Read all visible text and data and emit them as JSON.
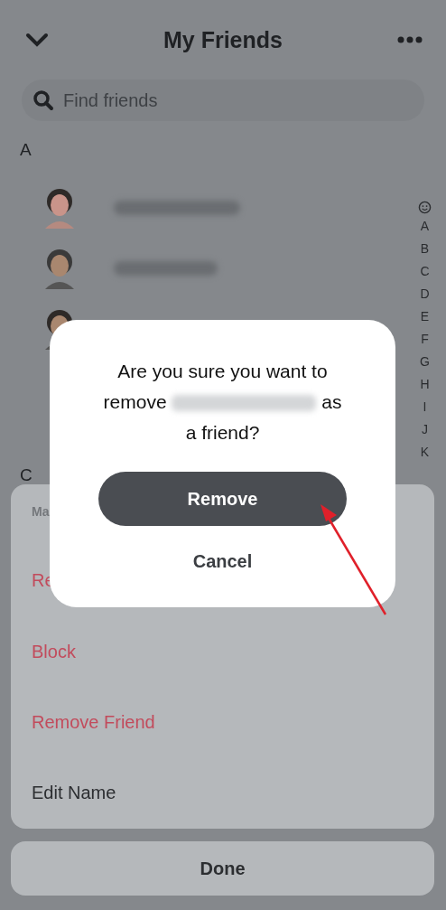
{
  "header": {
    "title": "My Friends"
  },
  "search": {
    "placeholder": "Find friends"
  },
  "sections": [
    {
      "letter": "A",
      "friends": [
        {
          "kind": "picture",
          "name_blurred": true
        },
        {
          "kind": "picture",
          "name_blurred": true
        },
        {
          "kind": "picture",
          "name_blurred": false
        }
      ]
    },
    {
      "letter": "C"
    }
  ],
  "index": [
    "A",
    "B",
    "C",
    "D",
    "E",
    "F",
    "G",
    "H",
    "I",
    "J",
    "K"
  ],
  "sheet": {
    "items": [
      {
        "kind": "header",
        "label": "Ma"
      },
      {
        "kind": "danger",
        "label": "Re"
      },
      {
        "kind": "danger",
        "label": "Block"
      },
      {
        "kind": "danger",
        "label": "Remove Friend"
      },
      {
        "kind": "normal",
        "label": "Edit Name"
      }
    ],
    "done": "Done"
  },
  "dialog": {
    "prompt_start": "Are you sure you want to remove",
    "prompt_end": "as a friend?",
    "confirm": "Remove",
    "cancel": "Cancel"
  }
}
